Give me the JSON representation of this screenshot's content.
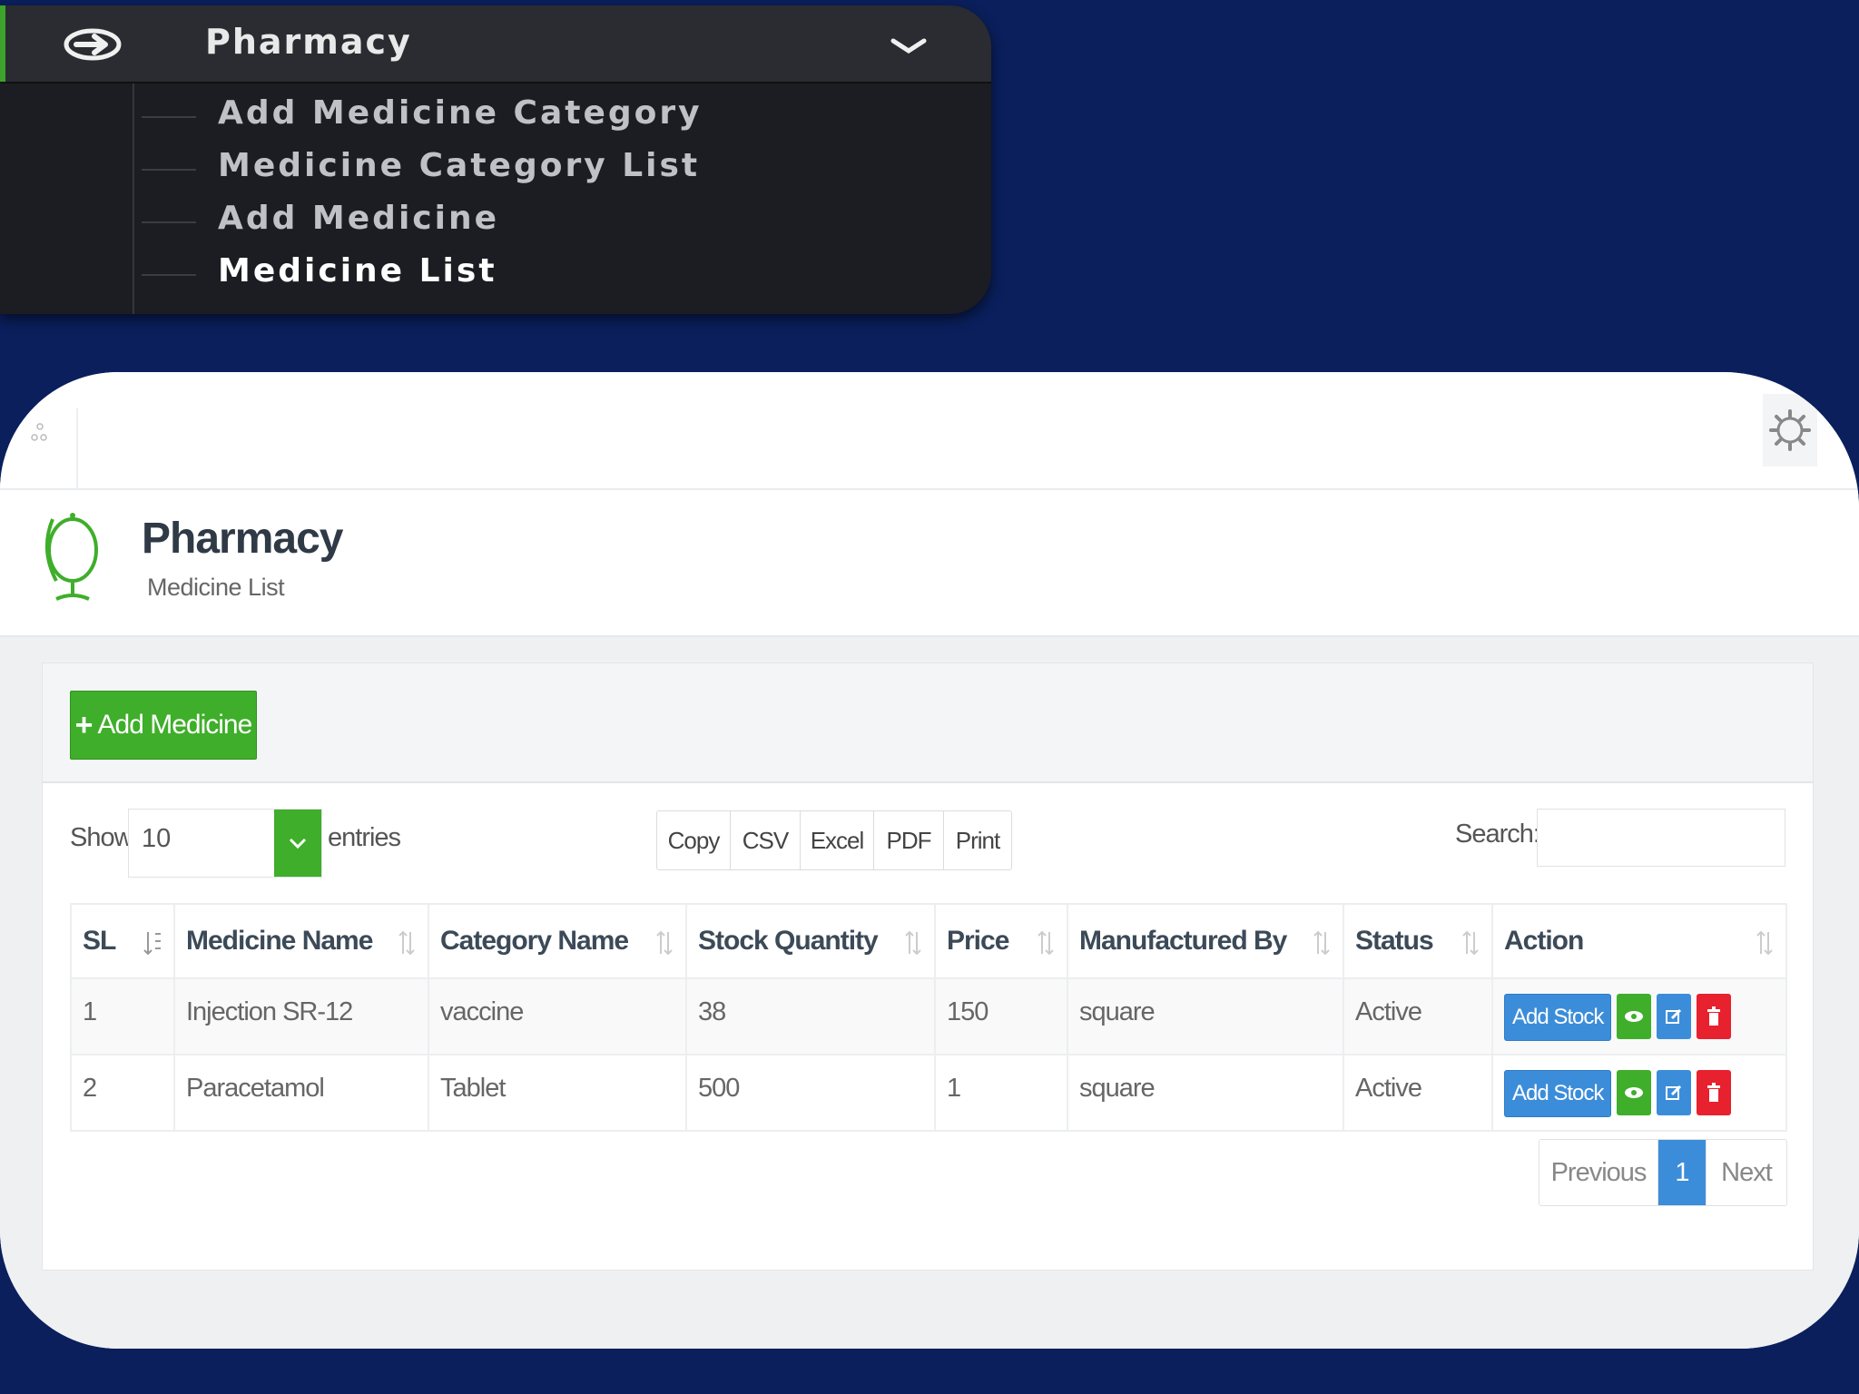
{
  "sidebar": {
    "section_title": "Pharmacy",
    "items": [
      {
        "label": "Add Medicine Category"
      },
      {
        "label": "Medicine Category List"
      },
      {
        "label": "Add Medicine"
      },
      {
        "label": "Medicine List"
      }
    ],
    "active_item": "Medicine List"
  },
  "header": {
    "title": "Pharmacy",
    "subtitle": "Medicine List"
  },
  "toolbar": {
    "add_label": "Add Medicine",
    "show_label": "Show",
    "page_length": "10",
    "entries_label": "entries",
    "export_buttons": [
      "Copy",
      "CSV",
      "Excel",
      "PDF",
      "Print"
    ],
    "search_label": "Search:",
    "search_value": ""
  },
  "table": {
    "columns": [
      "SL",
      "Medicine Name",
      "Category Name",
      "Stock Quantity",
      "Price",
      "Manufactured By",
      "Status",
      "Action"
    ],
    "rows": [
      {
        "sl": "1",
        "name": "Injection SR-12",
        "category": "vaccine",
        "stock": "38",
        "price": "150",
        "manufacturer": "square",
        "status": "Active",
        "action_label": "Add Stock"
      },
      {
        "sl": "2",
        "name": "Paracetamol",
        "category": "Tablet",
        "stock": "500",
        "price": "1",
        "manufacturer": "square",
        "status": "Active",
        "action_label": "Add Stock"
      }
    ]
  },
  "pagination": {
    "previous": "Previous",
    "current": "1",
    "next": "Next"
  },
  "colors": {
    "background": "#0a1f5c",
    "sidebar": "#1b1d22",
    "accent_green": "#3fae2a",
    "accent_blue": "#3c8dd9",
    "danger_red": "#e8212e"
  }
}
